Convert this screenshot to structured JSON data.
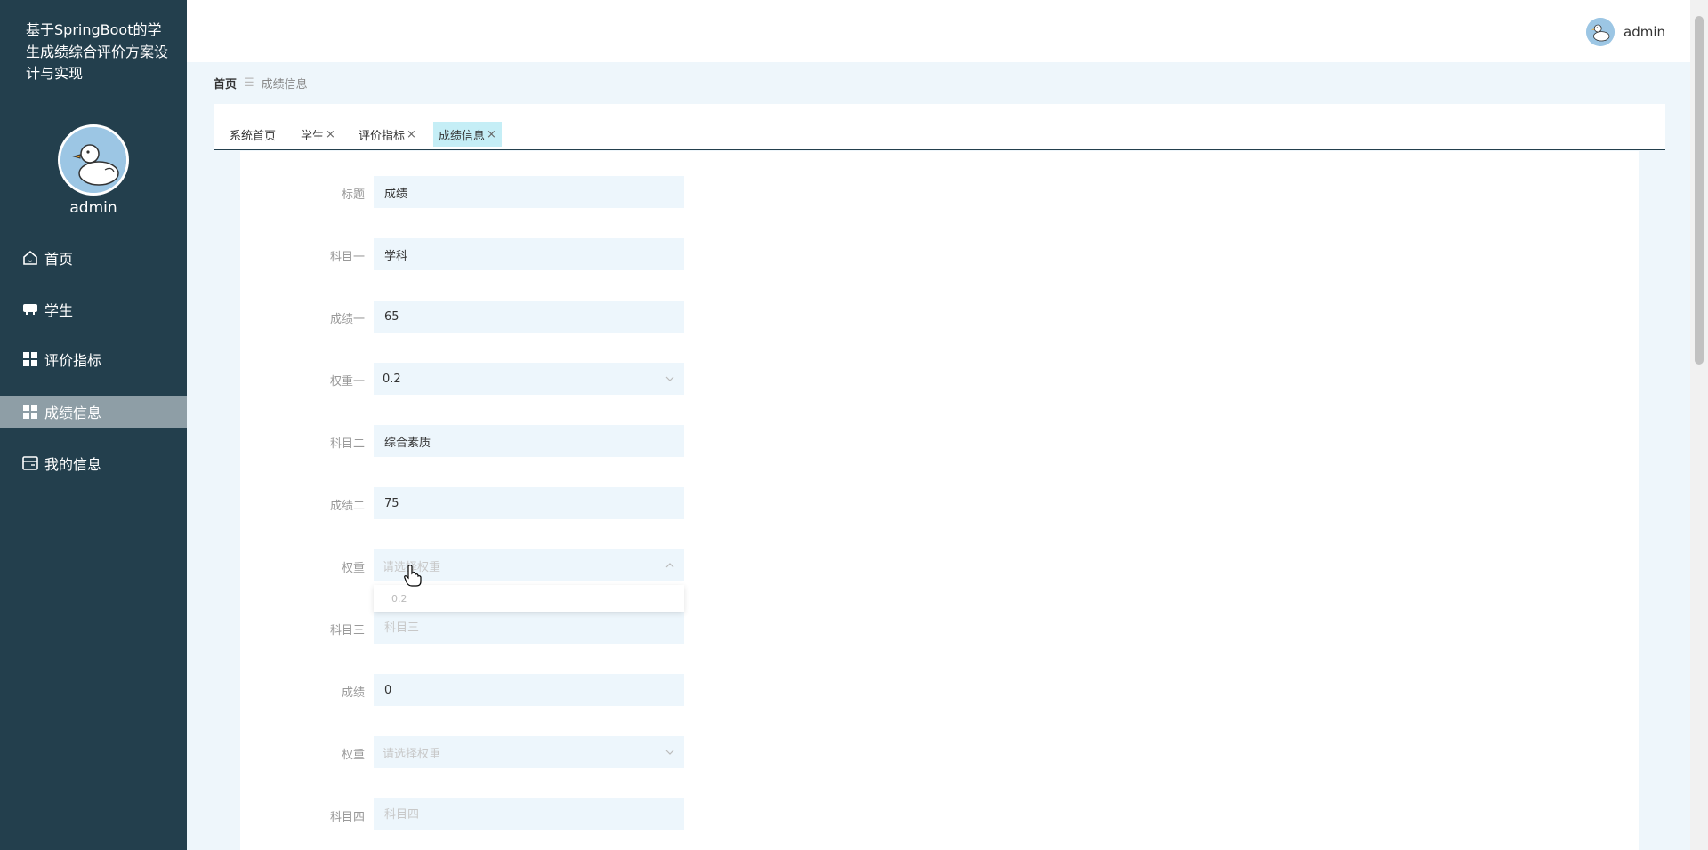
{
  "sidebar": {
    "app_title": "基于SpringBoot的学生成绩综合评价方案设计与实现",
    "username": "admin",
    "items": [
      {
        "label": "首页",
        "icon": "home-icon"
      },
      {
        "label": "学生",
        "icon": "student-icon"
      },
      {
        "label": "评价指标",
        "icon": "grid-icon"
      },
      {
        "label": "成绩信息",
        "icon": "grid-icon",
        "active": true
      },
      {
        "label": "我的信息",
        "icon": "card-icon"
      }
    ]
  },
  "header": {
    "username": "admin"
  },
  "breadcrumb": {
    "home": "首页",
    "separator": "☰",
    "current": "成绩信息"
  },
  "tabs": [
    {
      "label": "系统首页",
      "closable": false
    },
    {
      "label": "学生",
      "closable": true
    },
    {
      "label": "评价指标",
      "closable": true
    },
    {
      "label": "成绩信息",
      "closable": true,
      "active": true
    }
  ],
  "tab_close_glyph": "×",
  "form": {
    "fields": [
      {
        "label": "标题",
        "value": "成绩",
        "placeholder": ""
      },
      {
        "label": "科目一",
        "value": "学科",
        "placeholder": ""
      },
      {
        "label": "成绩一",
        "value": "65",
        "placeholder": ""
      },
      {
        "label": "权重一",
        "value": "0.2",
        "type": "select"
      },
      {
        "label": "科目二",
        "value": "综合素质",
        "placeholder": ""
      },
      {
        "label": "成绩二",
        "value": "75",
        "placeholder": ""
      },
      {
        "label": "权重",
        "value": "",
        "placeholder": "请选择权重",
        "type": "select",
        "open": true,
        "options": [
          "0.2"
        ]
      },
      {
        "label": "科目三",
        "value": "",
        "placeholder": "科目三"
      },
      {
        "label": "成绩",
        "value": "0",
        "placeholder": ""
      },
      {
        "label": "权重",
        "value": "",
        "placeholder": "请选择权重",
        "type": "select"
      },
      {
        "label": "科目四",
        "value": "",
        "placeholder": "科目四"
      }
    ]
  },
  "colors": {
    "sidebar_bg": "#233f4d",
    "sidebar_active": "#8e9ea6",
    "tab_active": "#c5eef6",
    "input_bg": "#edf6fc"
  }
}
